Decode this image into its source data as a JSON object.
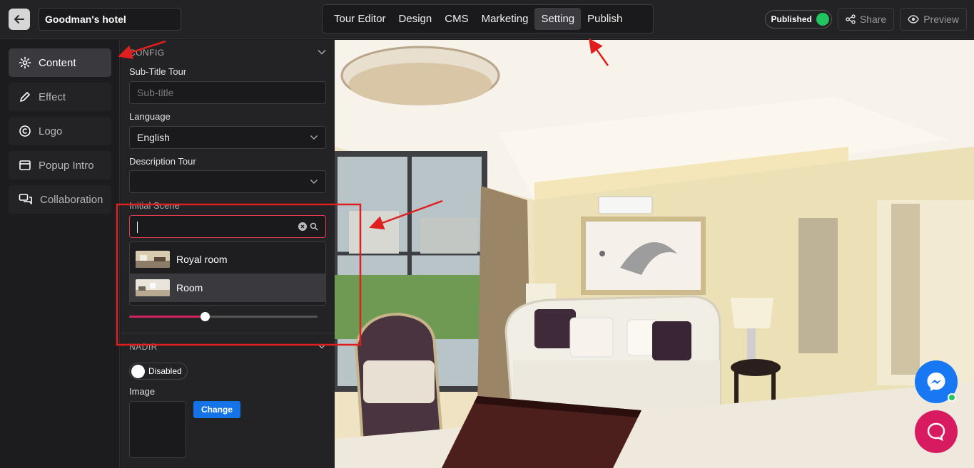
{
  "app": {
    "tour_title": "Goodman's hotel"
  },
  "nav": {
    "tabs": [
      "Tour Editor",
      "Design",
      "CMS",
      "Marketing",
      "Setting",
      "Publish"
    ],
    "active": "Setting"
  },
  "toolbar": {
    "status_label": "Published",
    "status_color": "#22c55e",
    "share_label": "Share",
    "preview_label": "Preview"
  },
  "sidebar": {
    "items": [
      {
        "label": "Content",
        "icon": "gear-icon",
        "active": true
      },
      {
        "label": "Effect",
        "icon": "pen-icon"
      },
      {
        "label": "Logo",
        "icon": "copyright-icon"
      },
      {
        "label": "Popup Intro",
        "icon": "window-icon"
      },
      {
        "label": "Collaboration",
        "icon": "chat-icon"
      }
    ]
  },
  "config": {
    "section_title": "CONFIG",
    "subtitle_label": "Sub-Title Tour",
    "subtitle_placeholder": "Sub-title",
    "language_label": "Language",
    "language_value": "English",
    "description_label": "Description Tour",
    "description_value": "",
    "initial_scene_label": "Initial Scene",
    "initial_scene_value": "",
    "scene_options": [
      "Royal room",
      "Room"
    ],
    "highlighted_option": "Room",
    "slider_value": 0.4
  },
  "nadir": {
    "section_title": "NADIR",
    "toggle_label": "Disabled",
    "image_label": "Image",
    "change_label": "Change"
  },
  "colors": {
    "accent": "#d0225d",
    "highlight_box": "#e01e1e",
    "messenger": "#1877f2",
    "chat": "#d81b60"
  }
}
